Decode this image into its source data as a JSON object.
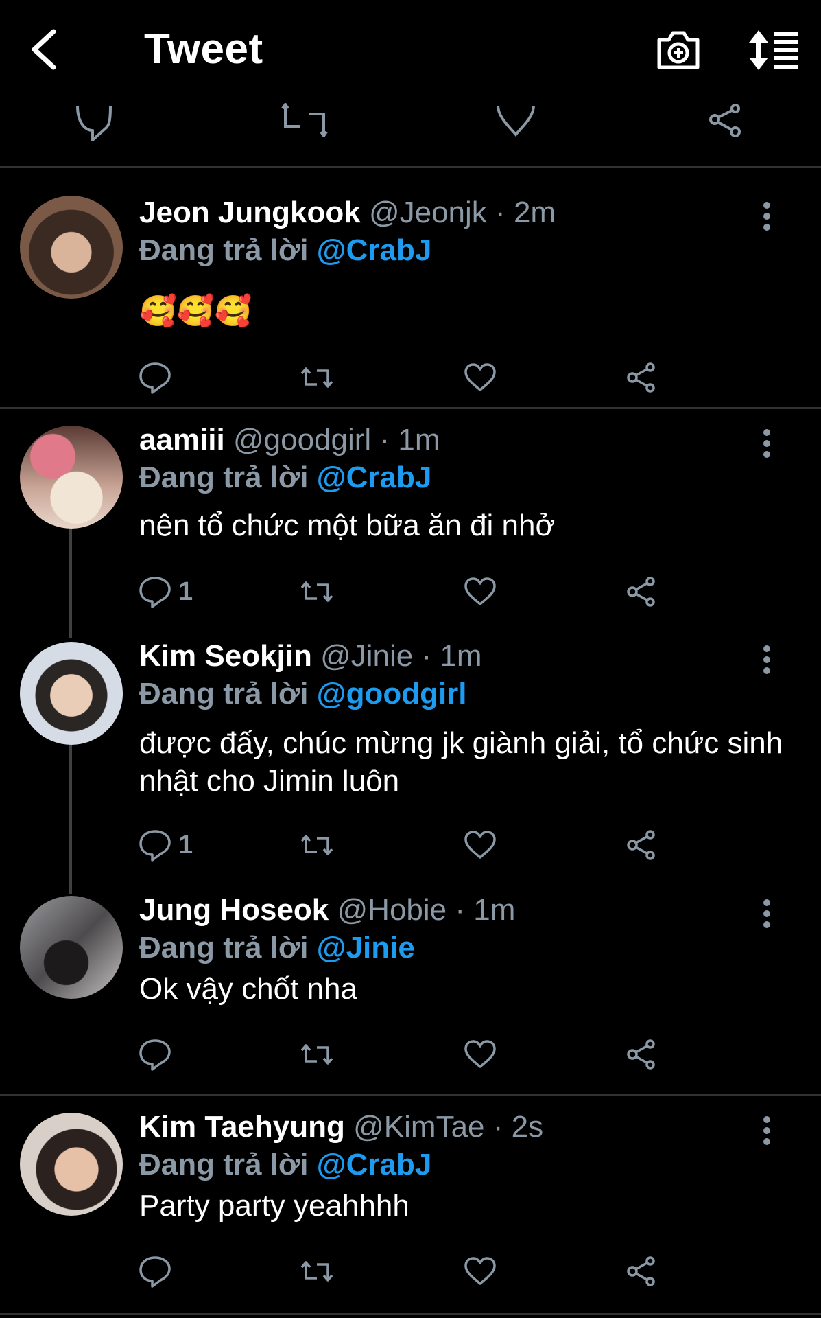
{
  "header": {
    "title": "Tweet"
  },
  "separator": "·",
  "reply_prefix": "Đang trả lời",
  "tweets": [
    {
      "name": "Jeon Jungkook",
      "handle": "@Jeonjk",
      "time": "2m",
      "reply_to": "@CrabJ",
      "text": "🥰🥰🥰",
      "reply_count": ""
    },
    {
      "name": "aamiii",
      "handle": "@goodgirl",
      "time": "1m",
      "reply_to": "@CrabJ",
      "text": "nên tổ chức một bữa ăn đi nhở",
      "reply_count": "1"
    },
    {
      "name": "Kim Seokjin",
      "handle": "@Jinie",
      "time": "1m",
      "reply_to": "@goodgirl",
      "text": "được đấy, chúc mừng jk giành giải, tổ chức sinh nhật cho Jimin luôn",
      "reply_count": "1"
    },
    {
      "name": "Jung Hoseok",
      "handle": "@Hobie",
      "time": "1m",
      "reply_to": "@Jinie",
      "text": "Ok vậy chốt nha",
      "reply_count": ""
    },
    {
      "name": "Kim Taehyung",
      "handle": "@KimTae",
      "time": "2s",
      "reply_to": "@CrabJ",
      "text": "Party party yeahhhh",
      "reply_count": ""
    }
  ],
  "colors": {
    "background": "#000000",
    "muted": "#8b98a5",
    "accent": "#1d9bf0",
    "divider": "#2f3336"
  }
}
